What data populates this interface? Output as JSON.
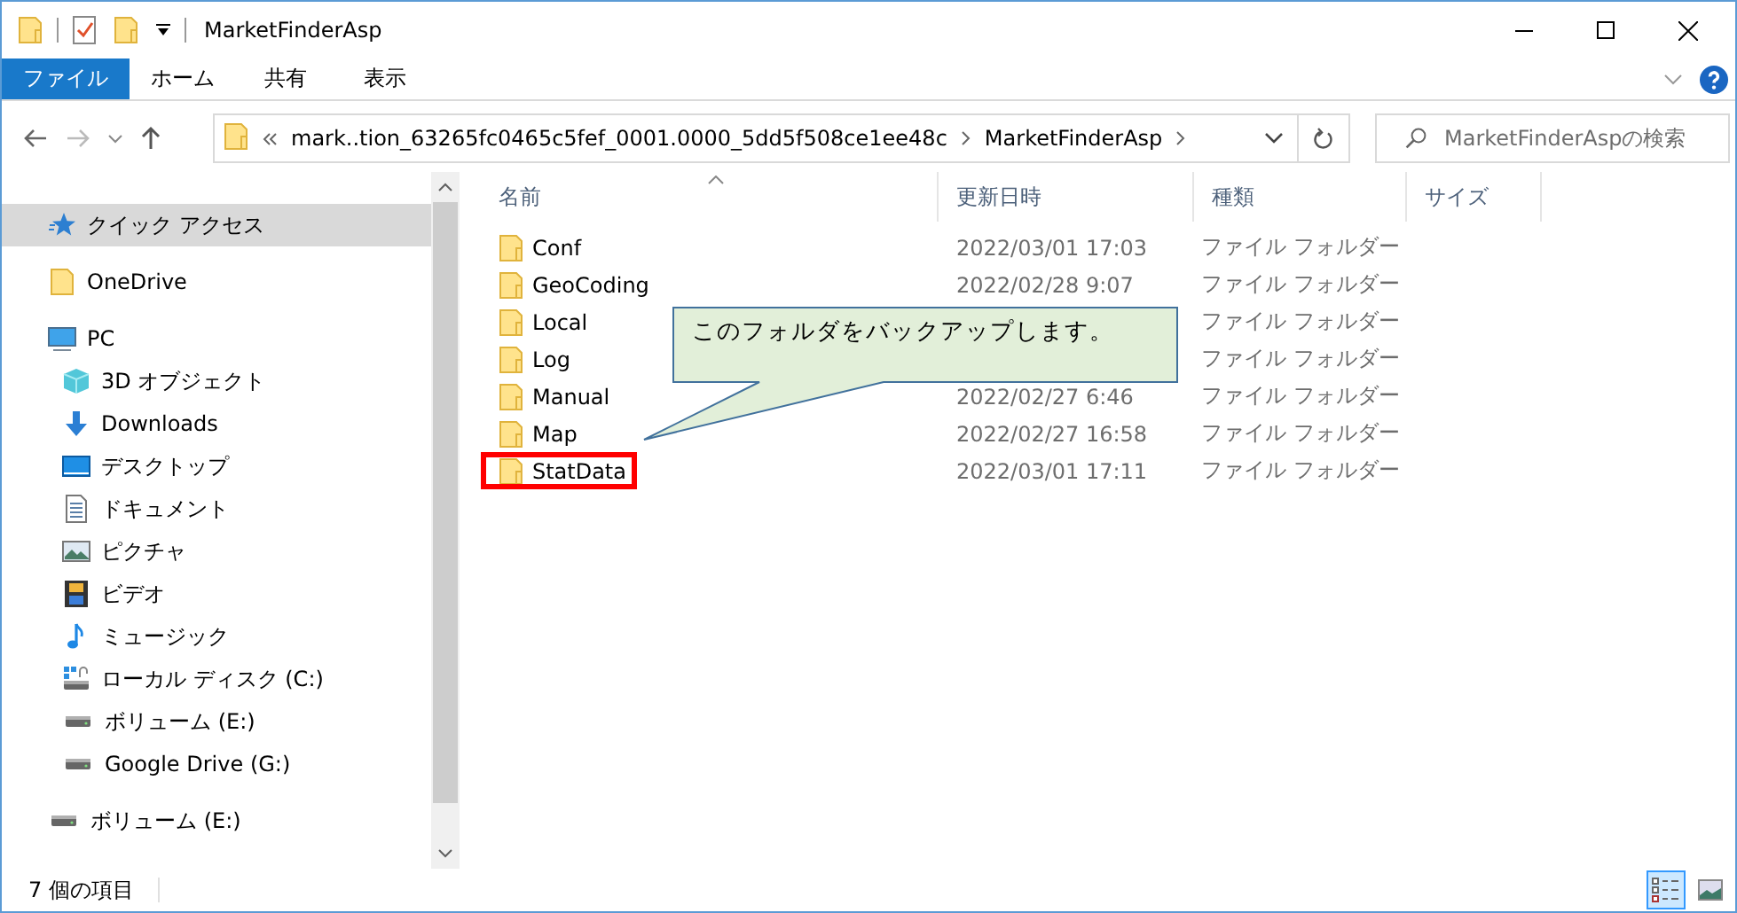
{
  "window": {
    "title": "MarketFinderAsp"
  },
  "ribbon": {
    "tabs": [
      {
        "label": "ファイル",
        "selected": true
      },
      {
        "label": "ホーム",
        "selected": false
      },
      {
        "label": "共有",
        "selected": false
      },
      {
        "label": "表示",
        "selected": false
      }
    ]
  },
  "address": {
    "path": [
      "mark..tion_63265fc0465c5fef_0001.0000_5dd5f508ce1ee48c",
      "MarketFinderAsp"
    ]
  },
  "search": {
    "placeholder": "MarketFinderAspの検索"
  },
  "sidebar": {
    "items": [
      {
        "label": "クイック アクセス",
        "kind": "star",
        "selected": true
      },
      {
        "label": "OneDrive",
        "kind": "folder",
        "selected": false
      },
      {
        "label": "PC",
        "kind": "pc",
        "selected": false,
        "children": [
          {
            "label": "3D オブジェクト",
            "kind": "cube",
            "selected": false
          },
          {
            "label": "Downloads",
            "kind": "download",
            "selected": false
          },
          {
            "label": "デスクトップ",
            "kind": "desktop",
            "selected": false
          },
          {
            "label": "ドキュメント",
            "kind": "document",
            "selected": false
          },
          {
            "label": "ピクチャ",
            "kind": "picture",
            "selected": false
          },
          {
            "label": "ビデオ",
            "kind": "video",
            "selected": false
          },
          {
            "label": "ミュージック",
            "kind": "music",
            "selected": false
          },
          {
            "label": "ローカル ディスク (C:)",
            "kind": "system-drive",
            "selected": false
          },
          {
            "label": "ボリューム (E:)",
            "kind": "drive",
            "selected": false
          },
          {
            "label": "Google Drive (G:)",
            "kind": "drive",
            "selected": false
          }
        ]
      },
      {
        "label": "ボリューム (E:)",
        "kind": "drive",
        "selected": false
      }
    ]
  },
  "table": {
    "columns": [
      "名前",
      "更新日時",
      "種類",
      "サイズ"
    ],
    "rows": [
      {
        "name": "Conf",
        "date": "2022/03/01 17:03",
        "type": "ファイル フォルダー",
        "highlighted": false
      },
      {
        "name": "GeoCoding",
        "date": "2022/02/28 9:07",
        "type": "ファイル フォルダー",
        "highlighted": false
      },
      {
        "name": "Local",
        "type": "ファイル フォルダー",
        "highlighted": false
      },
      {
        "name": "Log",
        "type": "ファイル フォルダー",
        "highlighted": false
      },
      {
        "name": "Manual",
        "date": "2022/02/27 6:46",
        "type": "ファイル フォルダー",
        "highlighted": false
      },
      {
        "name": "Map",
        "date": "2022/02/27 16:58",
        "type": "ファイル フォルダー",
        "highlighted": false
      },
      {
        "name": "StatData",
        "date": "2022/03/01 17:11",
        "type": "ファイル フォルダー",
        "highlighted": true
      }
    ]
  },
  "callout": {
    "text": "このフォルダをバックアップします。"
  },
  "status_bar": {
    "count": "7 個の項目",
    "views": [
      {
        "kind": "details",
        "selected": true
      },
      {
        "kind": "thumbnails",
        "selected": false
      }
    ]
  }
}
